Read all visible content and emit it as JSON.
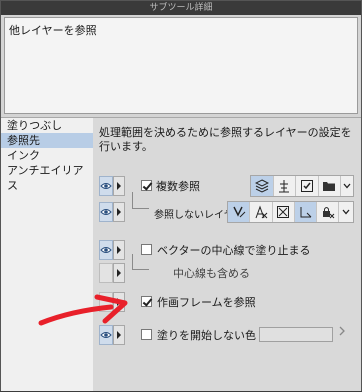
{
  "window": {
    "title": "サブツール詳細"
  },
  "description": {
    "text": "他レイヤーを参照"
  },
  "sidebar": {
    "items": [
      {
        "label": "塗りつぶし",
        "selected": false
      },
      {
        "label": "参照先",
        "selected": true
      },
      {
        "label": "インク",
        "selected": false
      },
      {
        "label": "アンチエイリアス",
        "selected": false
      }
    ]
  },
  "content": {
    "instruction": "処理範囲を決めるために参照するレイヤーの設定を行います。",
    "rows": {
      "multi_ref": {
        "label": "複数参照",
        "checked": true
      },
      "no_ref_layer": {
        "label": "参照しないレイヤー"
      },
      "vector_stop": {
        "label": "ベクターの中心線で塗り止まる",
        "checked": false
      },
      "include_center": {
        "label": "中心線も含める"
      },
      "ref_frame": {
        "label": "作画フレームを参照",
        "checked": true
      },
      "no_fill_color": {
        "label": "塗りを開始しない色",
        "checked": false
      }
    }
  },
  "colors": {
    "selection": "#b8cde6",
    "annotation_arrow": "#e8202a"
  }
}
